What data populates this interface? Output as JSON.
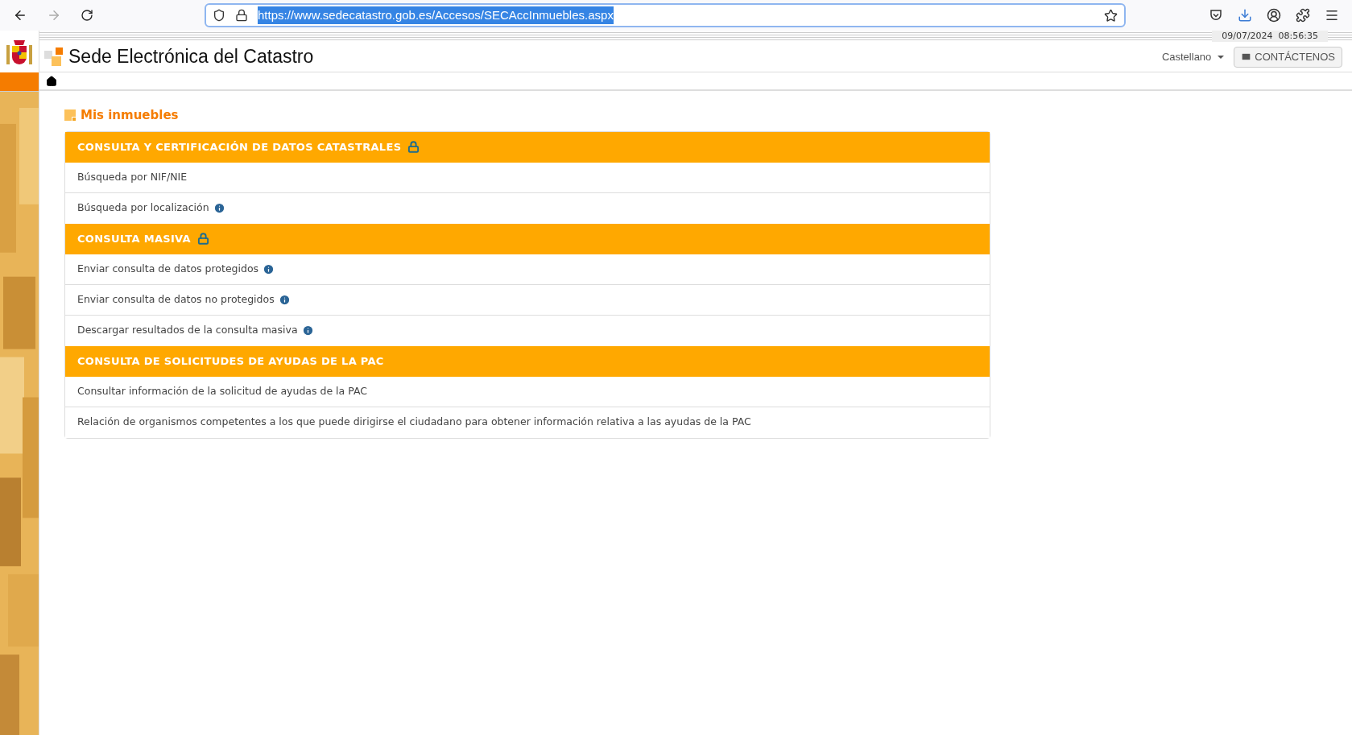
{
  "browser": {
    "url": "https://www.sedecatastro.gob.es/Accesos/SECAccInmuebles.aspx",
    "url_selected": true,
    "back_disabled": false,
    "forward_disabled": true
  },
  "header": {
    "datetime": "09/07/2024  08:56:35",
    "site_title": "Sede Electrónica del Catastro",
    "language": "Castellano",
    "contact_button": "CONTÁCTENOS"
  },
  "page_title": "Mis inmuebles",
  "sections": [
    {
      "title": "CONSULTA Y CERTIFICACIÓN DE DATOS CATASTRALES",
      "locked": true,
      "items": [
        {
          "label": "Búsqueda por NIF/NIE",
          "info": false
        },
        {
          "label": "Búsqueda por localización",
          "info": true
        }
      ]
    },
    {
      "title": "CONSULTA MASIVA",
      "locked": true,
      "items": [
        {
          "label": "Enviar consulta de datos protegidos",
          "info": true
        },
        {
          "label": "Enviar consulta de datos no protegidos",
          "info": true
        },
        {
          "label": "Descargar resultados de la consulta masiva",
          "info": true
        }
      ]
    },
    {
      "title": "CONSULTA DE SOLICITUDES DE AYUDAS DE LA PAC",
      "locked": false,
      "items": [
        {
          "label": "Consultar información de la solicitud de ayudas de la PAC",
          "info": false
        },
        {
          "label": "Relación de organismos competentes a los que puede dirigirse el ciudadano para obtener información relativa a las ayudas de la PAC",
          "info": false
        }
      ]
    }
  ]
}
